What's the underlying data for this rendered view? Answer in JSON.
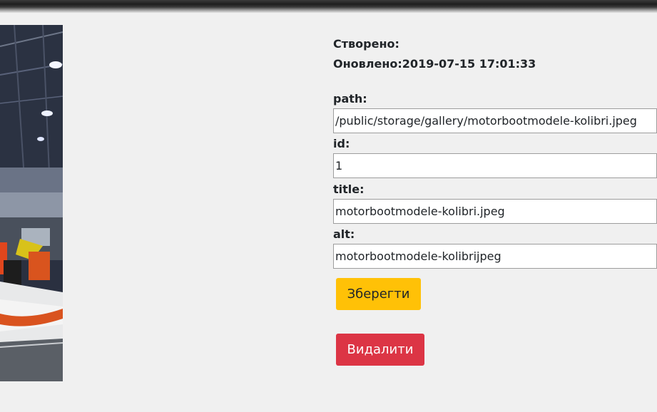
{
  "meta": {
    "created_label": "Створено:",
    "created_value": "",
    "updated_label": "Оновлено:",
    "updated_value": "2019-07-15 17:01:33"
  },
  "fields": {
    "path": {
      "label": "path:",
      "value": "/public/storage/gallery/motorbootmodele-kolibri.jpeg"
    },
    "id": {
      "label": "id:",
      "value": "1"
    },
    "title": {
      "label": "title:",
      "value": "motorbootmodele-kolibri.jpeg"
    },
    "alt": {
      "label": "alt:",
      "value": "motorbootmodele-kolibrijpeg"
    }
  },
  "buttons": {
    "save_label": "Зберегти",
    "delete_label": "Видалити"
  },
  "colors": {
    "save_button": "#ffc107",
    "delete_button": "#dc3545",
    "page_background": "#f0f0f0"
  }
}
